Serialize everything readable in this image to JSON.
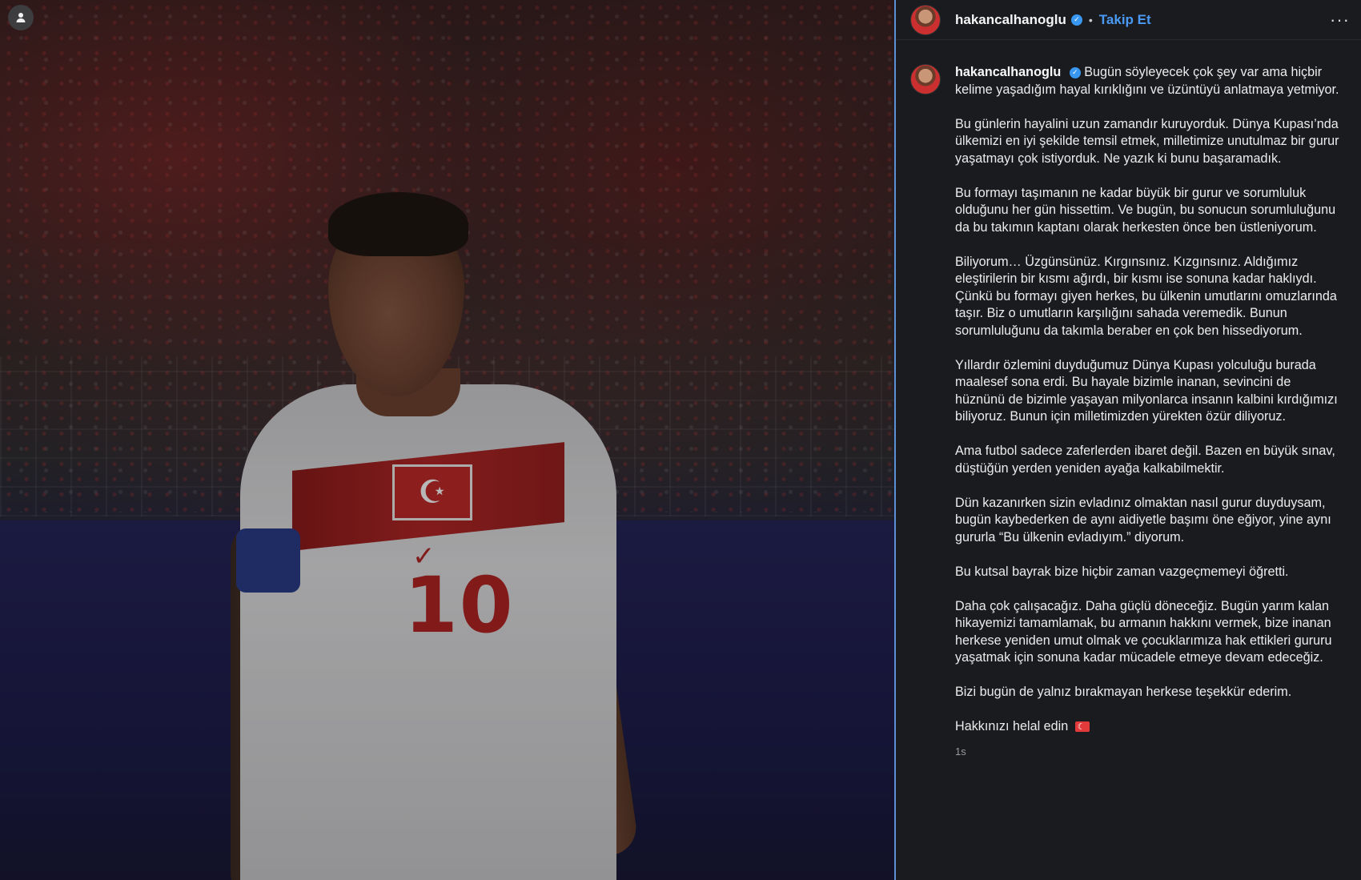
{
  "post": {
    "username": "hakancalhanoglu",
    "follow_label": "Takip Et",
    "separator": "•",
    "more_icon": "···",
    "verified_icon": "✓",
    "time": "1s",
    "caption_first": "Bugün söyleyecek çok şey var ama hiçbir kelime yaşadığım hayal kırıklığını ve üzüntüyü anlatmaya yetmiyor.",
    "paragraphs": [
      "Bu günlerin hayalini uzun zamandır kuruyorduk. Dünya Kupası’nda ülkemizi en iyi şekilde temsil etmek, milletimize unutulmaz bir gurur yaşatmayı çok istiyorduk. Ne yazık ki bunu başaramadık.",
      "Bu formayı taşımanın ne kadar büyük bir gurur ve sorumluluk olduğunu her gün hissettim. Ve bugün, bu sonucun sorumluluğunu da bu takımın kaptanı olarak herkesten önce ben üstleniyorum.",
      "Biliyorum… Üzgünsünüz. Kırgınsınız. Kızgınsınız. Aldığımız eleştirilerin bir kısmı ağırdı, bir kısmı ise sonuna kadar haklıydı. Çünkü bu formayı giyen herkes, bu ülkenin umutlarını omuzlarında taşır. Biz o umutların karşılığını sahada veremedik. Bunun sorumluluğunu da takımla beraber en çok ben hissediyorum.",
      "Yıllardır özlemini duyduğumuz Dünya Kupası yolculuğu burada maalesef sona erdi. Bu hayale bizimle inanan, sevincini de hüznünü de bizimle yaşayan milyonlarca insanın kalbini kırdığımızı biliyoruz. Bunun için milletimizden yürekten özür diliyoruz.",
      "Ama futbol sadece zaferlerden ibaret değil. Bazen en büyük sınav, düştüğün yerden yeniden ayağa kalkabilmektir.",
      "Dün kazanırken sizin evladınız olmaktan nasıl gurur duyduysam, bugün kaybederken de aynı aidiyetle başımı öne eğiyor, yine aynı gururla “Bu ülkenin evladıyım.” diyorum.",
      "Bu kutsal bayrak bize hiçbir zaman vazgeçmemeyi öğretti.",
      "Daha çok çalışacağız. Daha güçlü döneceğiz. Bugün yarım kalan hikayemizi tamamlamak, bu armanın hakkını vermek, bize inanan herkese yeniden umut olmak ve çocuklarımıza hak ettikleri gururu yaşatmak için sonuna kadar mücadele etmeye devam edeceğiz.",
      "Bizi bugün de yalnız bırakmayan herkese teşekkür ederim."
    ],
    "closing": "Hakkınızı helal edin",
    "closing_emoji": "turkey-flag-emoji"
  },
  "media": {
    "jersey_number": "10",
    "flag_symbol": "☪"
  },
  "colors": {
    "panel_bg": "#1a1b1f",
    "accent_blue": "#4a9af5",
    "verified_blue": "#3897f0",
    "divider": "#5c8fd6"
  }
}
